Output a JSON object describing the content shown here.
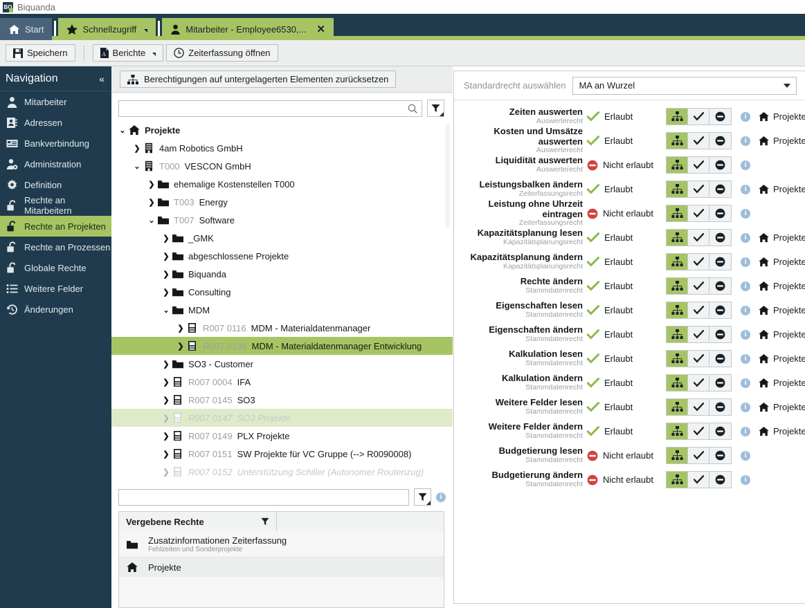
{
  "window": {
    "logo_text": "BQ",
    "title": "Biquanda"
  },
  "tabs": [
    {
      "label": "Start",
      "icon": "home-icon",
      "style": "dark",
      "caret": false,
      "close": false
    },
    {
      "label": "Schnellzugriff",
      "icon": "star-icon",
      "style": "green",
      "caret": true,
      "close": false
    },
    {
      "label": "Mitarbeiter - Employee6530,...",
      "icon": "person-icon",
      "style": "green",
      "caret": false,
      "close": true
    }
  ],
  "toolbar": {
    "save_label": "Speichern",
    "reports_label": "Berichte",
    "timetracking_label": "Zeiterfassung öffnen"
  },
  "sidebar": {
    "title": "Navigation",
    "collapse_icon": "chevron-double-left-icon",
    "items": [
      {
        "label": "Mitarbeiter",
        "icon": "person-icon",
        "active": false
      },
      {
        "label": "Adressen",
        "icon": "address-book-icon",
        "active": false
      },
      {
        "label": "Bankverbindung",
        "icon": "bank-card-icon",
        "active": false
      },
      {
        "label": "Administration",
        "icon": "person-gear-icon",
        "active": false
      },
      {
        "label": "Definition",
        "icon": "gear-icon",
        "active": false
      },
      {
        "label": "Rechte an Mitarbeitern",
        "icon": "lock-open-icon",
        "active": false
      },
      {
        "label": "Rechte an Projekten",
        "icon": "lock-open-icon",
        "active": true
      },
      {
        "label": "Rechte an Prozessen",
        "icon": "lock-open-icon",
        "active": false
      },
      {
        "label": "Globale Rechte",
        "icon": "lock-open-icon",
        "active": false
      },
      {
        "label": "Weitere Felder",
        "icon": "list-icon",
        "active": false
      },
      {
        "label": "Änderungen",
        "icon": "history-icon",
        "active": false
      }
    ]
  },
  "center": {
    "reset_button": "Berechtigungen auf untergelagerten Elementen zurücksetzen",
    "reset_icon": "hierarchy-icon",
    "search": {
      "value": "",
      "placeholder": "",
      "icon": "search-icon"
    },
    "filter_icon": "filter-icon",
    "lower_search": {
      "value": "",
      "placeholder": ""
    },
    "lower_info_icon": "info-icon",
    "tree": [
      {
        "depth": 0,
        "label": "Projekte",
        "num": "",
        "icon": "home-icon",
        "expanded": true,
        "bold": true,
        "state": ""
      },
      {
        "depth": 1,
        "label": "4am Robotics GmbH",
        "num": "",
        "icon": "building-icon",
        "expanded": false,
        "bold": false,
        "state": ""
      },
      {
        "depth": 1,
        "label": "VESCON GmbH",
        "num": "T000",
        "icon": "building-icon",
        "expanded": true,
        "bold": false,
        "state": ""
      },
      {
        "depth": 2,
        "label": "ehemalige Kostenstellen T000",
        "num": "",
        "icon": "folder-icon",
        "expanded": false,
        "bold": false,
        "state": ""
      },
      {
        "depth": 2,
        "label": "Energy",
        "num": "T003",
        "icon": "folder-icon",
        "expanded": false,
        "bold": false,
        "state": ""
      },
      {
        "depth": 2,
        "label": "Software",
        "num": "T007",
        "icon": "folder-icon",
        "expanded": true,
        "bold": false,
        "state": ""
      },
      {
        "depth": 3,
        "label": "_GMK",
        "num": "",
        "icon": "folder-icon",
        "expanded": false,
        "bold": false,
        "state": ""
      },
      {
        "depth": 3,
        "label": "abgeschlossene Projekte",
        "num": "",
        "icon": "folder-icon",
        "expanded": false,
        "bold": false,
        "state": ""
      },
      {
        "depth": 3,
        "label": "Biquanda",
        "num": "",
        "icon": "folder-icon",
        "expanded": false,
        "bold": false,
        "state": ""
      },
      {
        "depth": 3,
        "label": "Consulting",
        "num": "",
        "icon": "folder-icon",
        "expanded": false,
        "bold": false,
        "state": ""
      },
      {
        "depth": 3,
        "label": "MDM",
        "num": "",
        "icon": "folder-icon",
        "expanded": true,
        "bold": false,
        "state": ""
      },
      {
        "depth": 4,
        "label": "MDM - Materialdatenmanager",
        "num": "R007 0116",
        "icon": "project-icon",
        "expanded": false,
        "bold": false,
        "state": ""
      },
      {
        "depth": 4,
        "label": "MDM - Materialdatenmanager Entwicklung",
        "num": "R007 0136",
        "icon": "project-icon",
        "expanded": false,
        "bold": false,
        "state": "sel"
      },
      {
        "depth": 3,
        "label": "SO3 - Customer",
        "num": "",
        "icon": "folder-icon",
        "expanded": false,
        "bold": false,
        "state": ""
      },
      {
        "depth": 3,
        "label": "IFA",
        "num": "R007 0004",
        "icon": "project-icon",
        "expanded": false,
        "bold": false,
        "state": ""
      },
      {
        "depth": 3,
        "label": "SO3",
        "num": "R007 0145",
        "icon": "project-icon",
        "expanded": false,
        "bold": false,
        "state": ""
      },
      {
        "depth": 3,
        "label": "SO3 Projekte",
        "num": "R007 0147",
        "icon": "project-icon",
        "expanded": false,
        "bold": false,
        "state": "sel2-dim"
      },
      {
        "depth": 3,
        "label": "PLX Projekte",
        "num": "R007 0149",
        "icon": "project-icon",
        "expanded": false,
        "bold": false,
        "state": ""
      },
      {
        "depth": 3,
        "label": "SW Projekte für VC Gruppe (--> R0090008)",
        "num": "R007 0151",
        "icon": "project-icon",
        "expanded": false,
        "bold": false,
        "state": ""
      },
      {
        "depth": 3,
        "label": "Unterstützung Schiller (Autonomer Routenzug)",
        "num": "R007 0152",
        "icon": "project-icon",
        "expanded": false,
        "bold": false,
        "state": "dim"
      }
    ],
    "granted": {
      "header": "Vergebene Rechte",
      "header_filter_icon": "filter-icon",
      "rows": [
        {
          "title": "Zusatzinformationen Zeiterfassung",
          "sub": "Fehlzeiten und Sonderprojekte",
          "icon": "folder-icon"
        },
        {
          "title": "Projekte",
          "sub": "",
          "icon": "home-icon"
        }
      ]
    }
  },
  "right": {
    "standard_label": "Standardrecht auswählen",
    "standard_value": "MA an Wurzel",
    "allowed_text": "Erlaubt",
    "denied_text": "Nicht erlaubt",
    "scope_label": "Projekte",
    "scope_icon": "home-icon",
    "permissions": [
      {
        "name": "Zeiten auswerten",
        "category": "Auswerterecht",
        "allowed": true,
        "scope": true
      },
      {
        "name": "Kosten und Umsätze auswerten",
        "category": "Auswerterecht",
        "allowed": true,
        "scope": true
      },
      {
        "name": "Liquidität auswerten",
        "category": "Auswerterecht",
        "allowed": false,
        "scope": false
      },
      {
        "name": "Leistungsbalken ändern",
        "category": "Zeiterfassungsrecht",
        "allowed": true,
        "scope": true
      },
      {
        "name": "Leistung ohne Uhrzeit eintragen",
        "category": "Zeiterfassungsrecht",
        "allowed": false,
        "scope": false
      },
      {
        "name": "Kapazitätsplanung lesen",
        "category": "Kapazitätsplanungsrecht",
        "allowed": true,
        "scope": true
      },
      {
        "name": "Kapazitätsplanung ändern",
        "category": "Kapazitätsplanungsrecht",
        "allowed": true,
        "scope": true
      },
      {
        "name": "Rechte ändern",
        "category": "Stammdatenrecht",
        "allowed": true,
        "scope": true
      },
      {
        "name": "Eigenschaften lesen",
        "category": "Stammdatenrecht",
        "allowed": true,
        "scope": true
      },
      {
        "name": "Eigenschaften ändern",
        "category": "Stammdatenrecht",
        "allowed": true,
        "scope": true
      },
      {
        "name": "Kalkulation lesen",
        "category": "Stammdatenrecht",
        "allowed": true,
        "scope": true
      },
      {
        "name": "Kalkulation ändern",
        "category": "Stammdatenrecht",
        "allowed": true,
        "scope": true
      },
      {
        "name": "Weitere Felder lesen",
        "category": "Stammdatenrecht",
        "allowed": true,
        "scope": true
      },
      {
        "name": "Weitere Felder ändern",
        "category": "Stammdatenrecht",
        "allowed": true,
        "scope": true
      },
      {
        "name": "Budgetierung lesen",
        "category": "Stammdatenrecht",
        "allowed": false,
        "scope": false
      },
      {
        "name": "Budgetierung ändern",
        "category": "Stammdatenrecht",
        "allowed": false,
        "scope": false
      }
    ]
  },
  "colors": {
    "dark": "#1f3b4d",
    "accent_green": "#a7c463",
    "allow_green": "#8cba45",
    "deny_red": "#d5413c",
    "info_blue": "#9fbdd9"
  }
}
